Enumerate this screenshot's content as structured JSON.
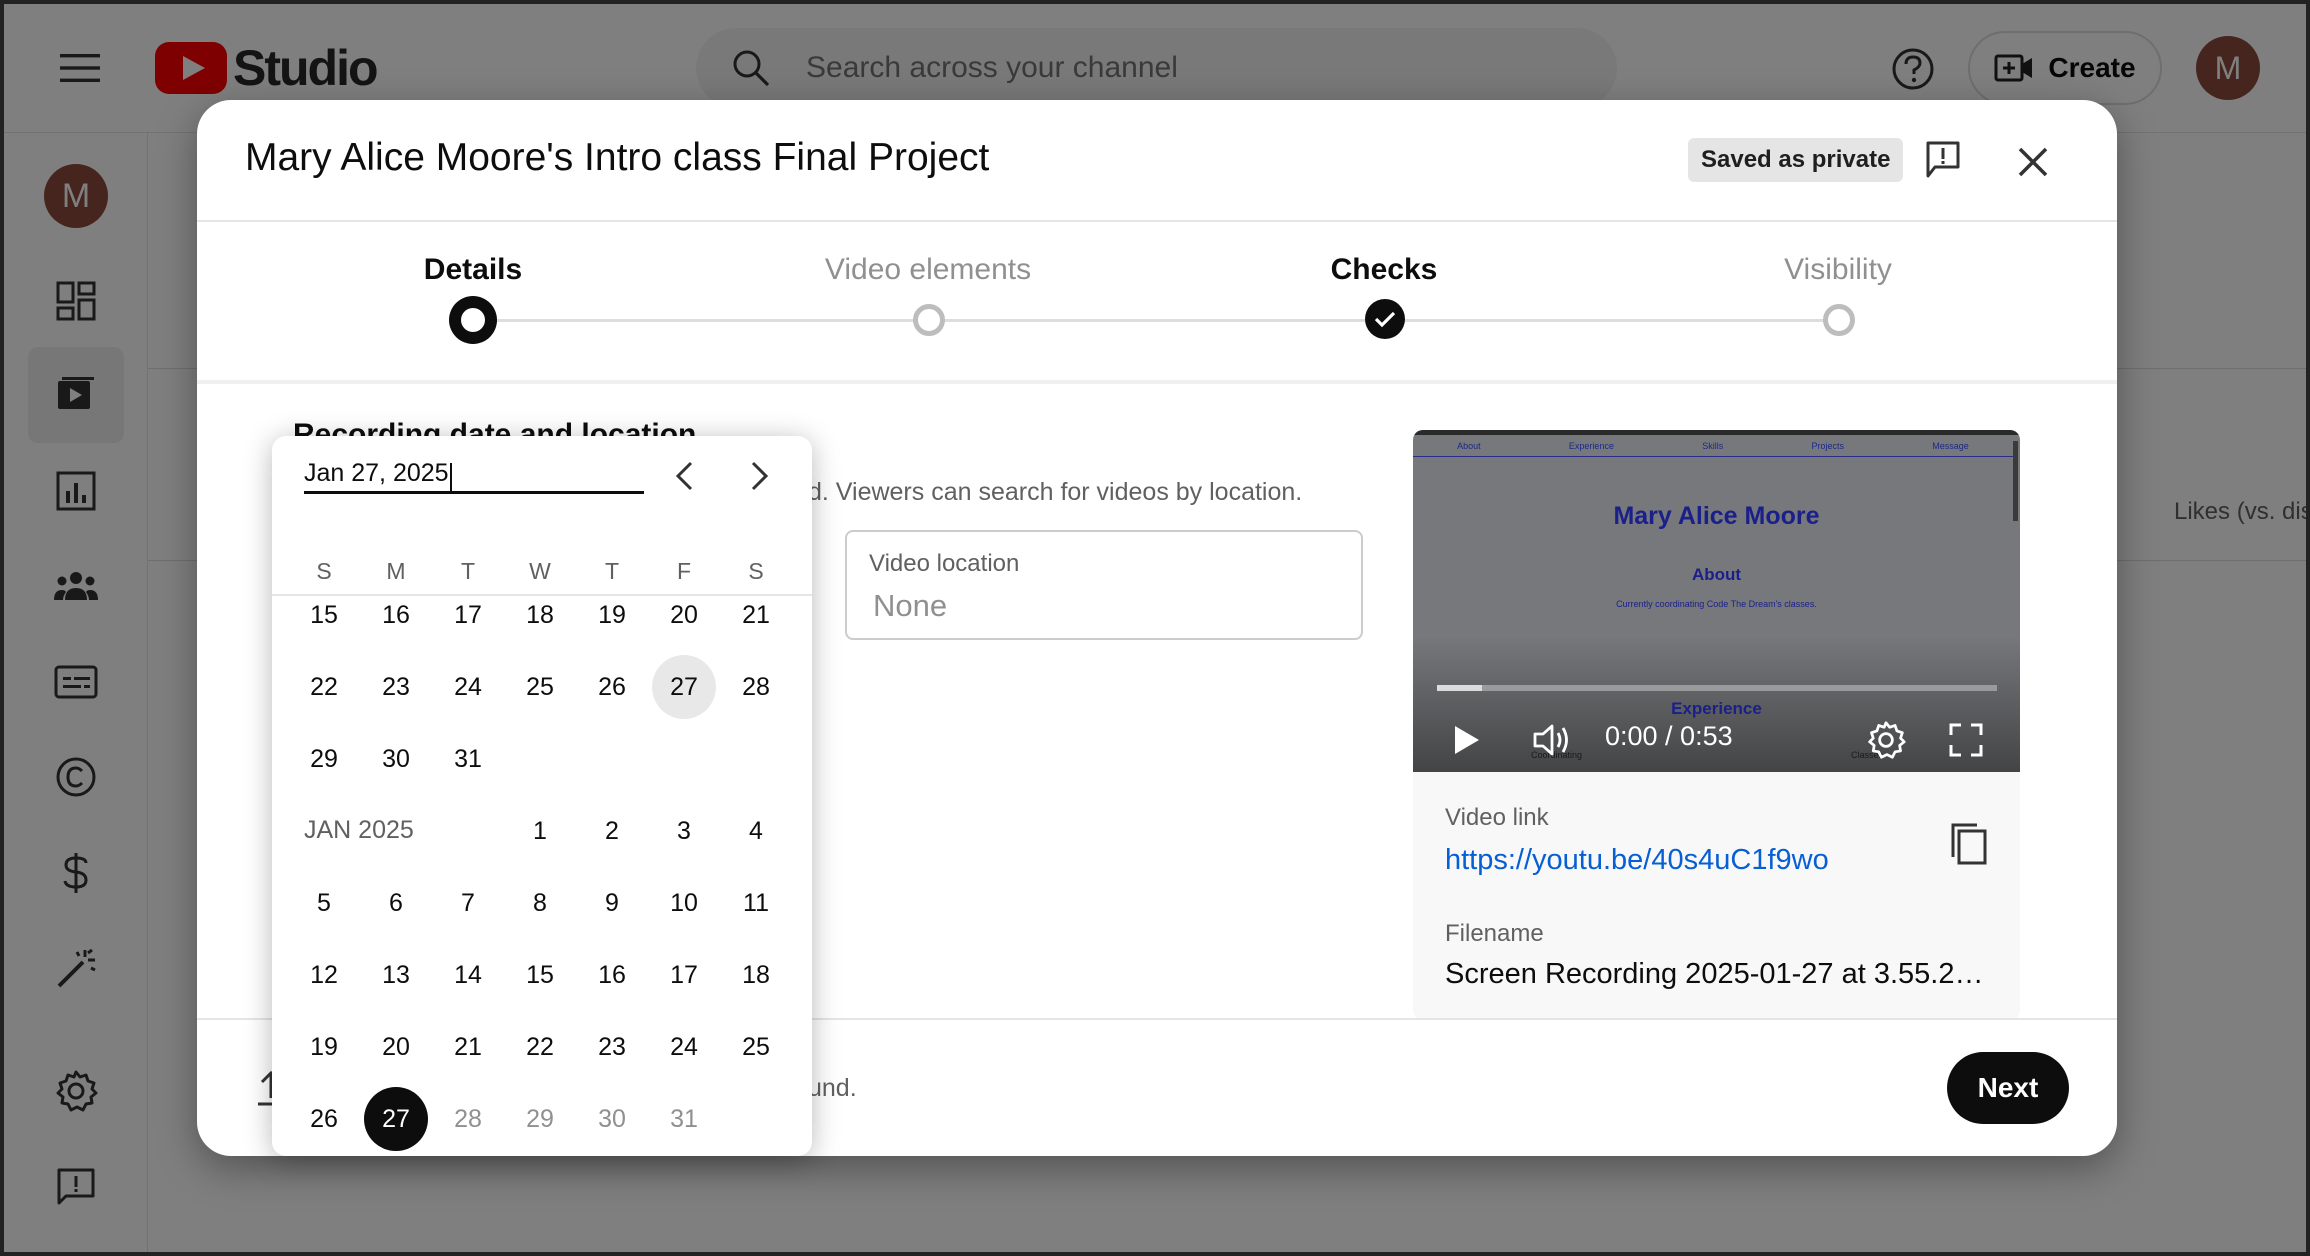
{
  "app": {
    "logo_text": "Studio",
    "search_placeholder": "Search across your channel",
    "create_label": "Create",
    "avatar_initial": "M"
  },
  "sidebar": {
    "avatar_initial": "M",
    "items": [
      "dashboard-icon",
      "content-icon",
      "analytics-icon",
      "community-icon",
      "subtitles-icon",
      "copyright-icon",
      "earn-icon",
      "customization-icon",
      "settings-icon",
      "send-feedback-icon"
    ],
    "active_index": 1
  },
  "background": {
    "column_header": "Likes (vs. dis",
    "column_header_partial": "s"
  },
  "dialog": {
    "title": "Mary Alice Moore's Intro class Final Project",
    "saved_badge": "Saved as private",
    "steps": [
      {
        "label": "Details",
        "state": "current"
      },
      {
        "label": "Video elements",
        "state": "todo"
      },
      {
        "label": "Checks",
        "state": "done"
      },
      {
        "label": "Visibility",
        "state": "todo"
      }
    ],
    "section_title": "Recording date and location",
    "section_desc_visible": "d. Viewers can search for videos by location.",
    "video_location_label": "Video location",
    "video_location_value": "None",
    "video_link_label": "Video link",
    "video_link": "https://youtu.be/40s4uC1f9wo",
    "filename_label": "Filename",
    "filename": "Screen Recording 2025-01-27 at 3.55.2…",
    "footer_status_visible": "und.",
    "next_label": "Next"
  },
  "video": {
    "time": "0:00 / 0:53",
    "buffered_fraction": 0.08,
    "page_nav": [
      "About",
      "Experience",
      "Skills",
      "Projects",
      "Message"
    ],
    "page_name": "Mary Alice Moore",
    "page_about": "About",
    "page_blurb": "Currently coordinating Code The Dream's classes.",
    "page_experience": "Experience",
    "page_coordinating": "Coordinating",
    "page_classes": "Classes"
  },
  "datepicker": {
    "input_value": "Jan 27, 2025",
    "weekdays": [
      "S",
      "M",
      "T",
      "W",
      "T",
      "F",
      "S"
    ],
    "month_label": "JAN 2025",
    "rows": [
      [
        {
          "d": "15"
        },
        {
          "d": "16"
        },
        {
          "d": "17"
        },
        {
          "d": "18"
        },
        {
          "d": "19"
        },
        {
          "d": "20"
        },
        {
          "d": "21"
        }
      ],
      [
        {
          "d": "22"
        },
        {
          "d": "23"
        },
        {
          "d": "24"
        },
        {
          "d": "25"
        },
        {
          "d": "26"
        },
        {
          "d": "27",
          "state": "hover"
        },
        {
          "d": "28"
        }
      ],
      [
        {
          "d": "29"
        },
        {
          "d": "30"
        },
        {
          "d": "31"
        }
      ],
      [
        {
          "month": true
        },
        null,
        null,
        {
          "d": "1"
        },
        {
          "d": "2"
        },
        {
          "d": "3"
        },
        {
          "d": "4"
        }
      ],
      [
        {
          "d": "5"
        },
        {
          "d": "6"
        },
        {
          "d": "7"
        },
        {
          "d": "8"
        },
        {
          "d": "9"
        },
        {
          "d": "10"
        },
        {
          "d": "11"
        }
      ],
      [
        {
          "d": "12"
        },
        {
          "d": "13"
        },
        {
          "d": "14"
        },
        {
          "d": "15"
        },
        {
          "d": "16"
        },
        {
          "d": "17"
        },
        {
          "d": "18"
        }
      ],
      [
        {
          "d": "19"
        },
        {
          "d": "20"
        },
        {
          "d": "21"
        },
        {
          "d": "22"
        },
        {
          "d": "23"
        },
        {
          "d": "24"
        },
        {
          "d": "25"
        }
      ],
      [
        {
          "d": "26"
        },
        {
          "d": "27",
          "state": "selected"
        },
        {
          "d": "28",
          "state": "other"
        },
        {
          "d": "29",
          "state": "other"
        },
        {
          "d": "30",
          "state": "other"
        },
        {
          "d": "31",
          "state": "other"
        }
      ]
    ]
  },
  "colors": {
    "accent_red": "#ff0000",
    "link_blue": "#065fd4",
    "primary_dark": "#0d0d0d"
  }
}
